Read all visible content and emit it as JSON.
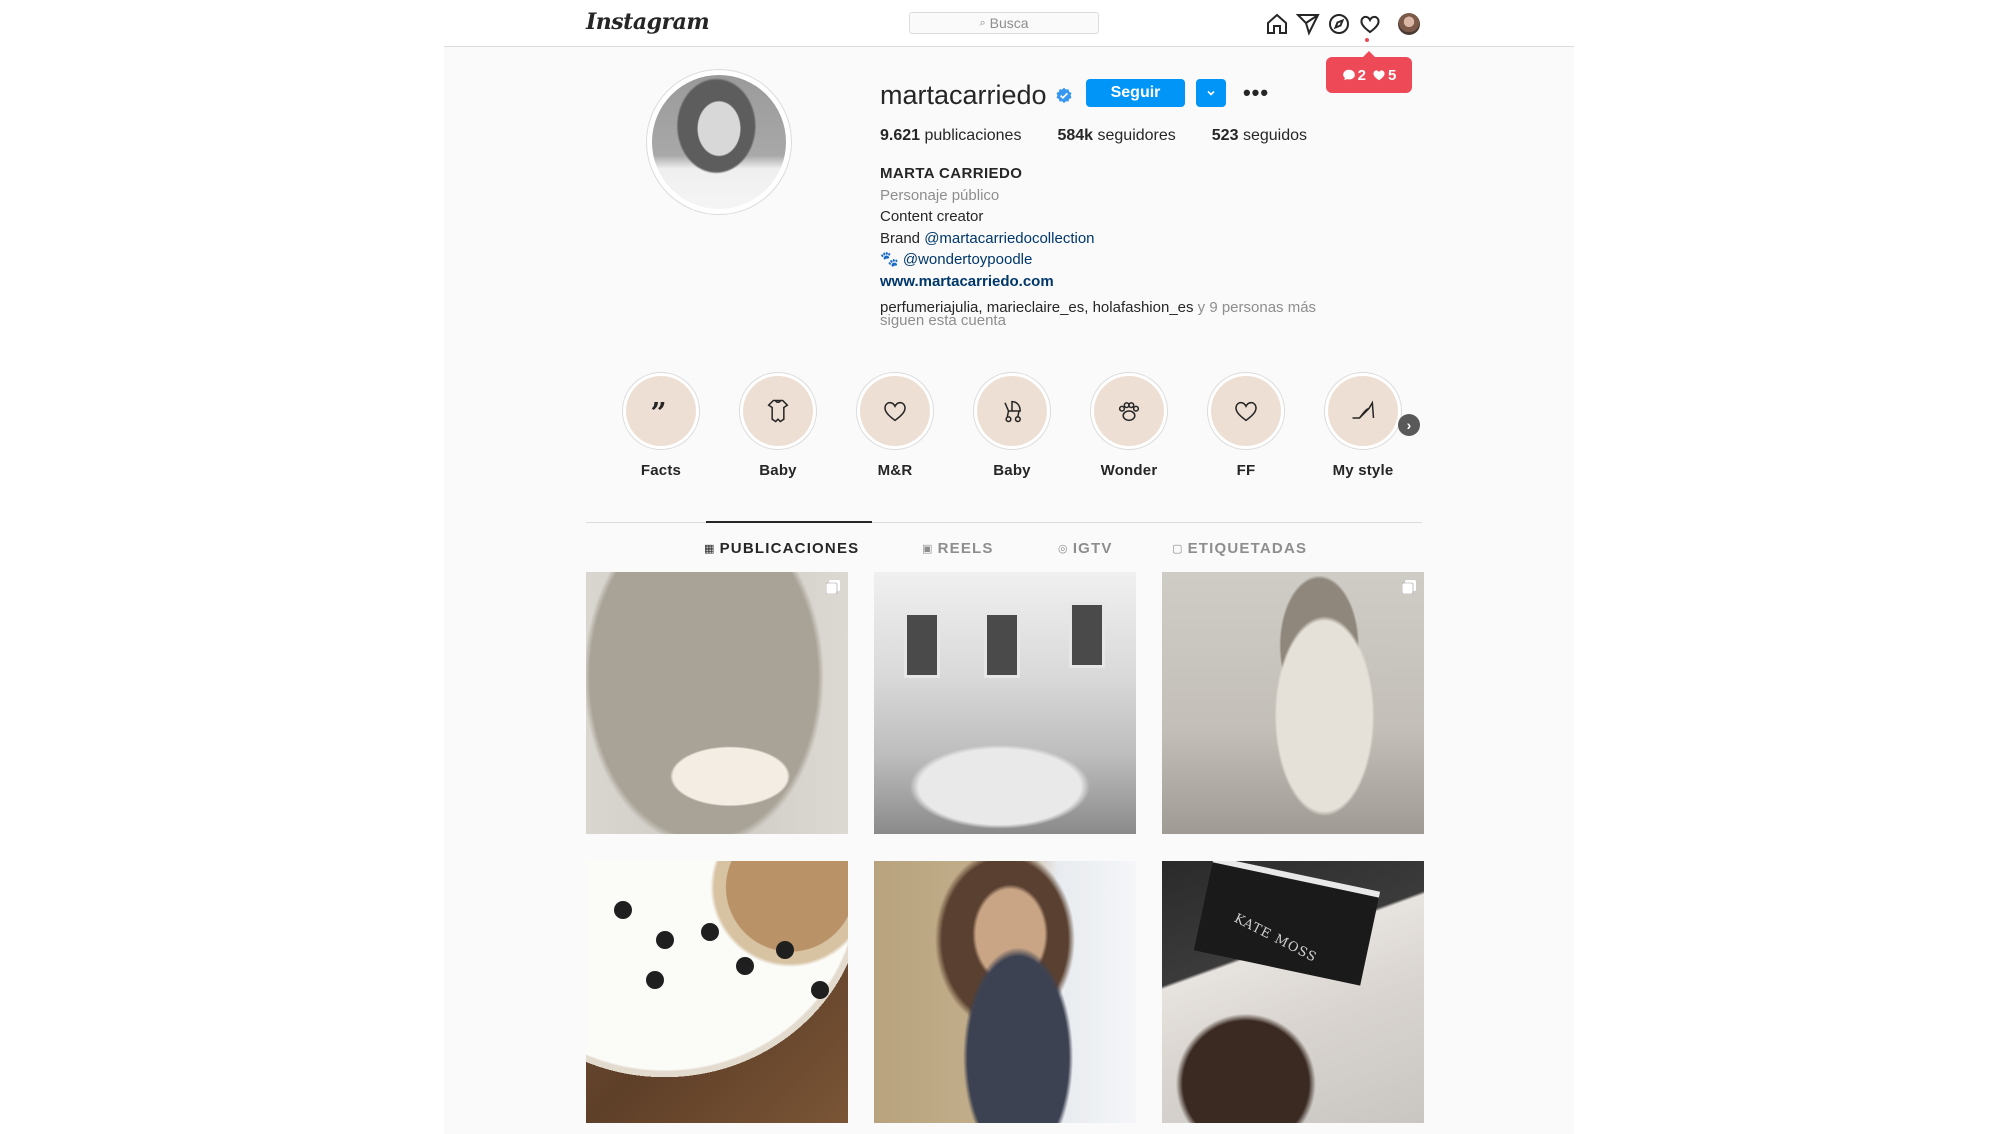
{
  "header": {
    "logo": "Instagram",
    "search_placeholder": "Busca",
    "notifications": {
      "comments": "2",
      "likes": "5"
    }
  },
  "profile": {
    "username": "martacarriedo",
    "follow_label": "Seguir",
    "stats": {
      "posts_count": "9.621",
      "posts_label": "publicaciones",
      "followers_count": "584k",
      "followers_label": "seguidores",
      "following_count": "523",
      "following_label": "seguidos"
    },
    "bio": {
      "name": "MARTA CARRIEDO",
      "category": "Personaje público",
      "line1": "Content creator",
      "brand_prefix": "Brand ",
      "brand_handle": "@martacarriedocollection",
      "pet_emoji": "🐾",
      "pet_handle": "@wondertoypoodle",
      "website": "www.martacarriedo.com"
    },
    "followed_by": {
      "accounts": "perfumeriajulia, marieclaire_es, holafashion_es",
      "rest": " y 9 personas más",
      "suffix": "siguen esta cuenta"
    }
  },
  "highlights": [
    {
      "label": "Facts",
      "icon": "quote-icon"
    },
    {
      "label": "Baby",
      "icon": "onesie-icon"
    },
    {
      "label": "M&R",
      "icon": "heart-icon"
    },
    {
      "label": "Baby",
      "icon": "stroller-icon"
    },
    {
      "label": "Wonder",
      "icon": "paw-icon"
    },
    {
      "label": "FF",
      "icon": "heart-icon"
    },
    {
      "label": "My style",
      "icon": "heel-shoe-icon"
    }
  ],
  "tabs": [
    {
      "label": "PUBLICACIONES",
      "active": true
    },
    {
      "label": "REELS",
      "active": false
    },
    {
      "label": "IGTV",
      "active": false
    },
    {
      "label": "ETIQUETADAS",
      "active": false
    }
  ],
  "posts": {
    "p6_book_text": "KATE MOSS"
  },
  "colors": {
    "accent": "#0095f6",
    "notification": "#ed4956",
    "link": "#00376b",
    "highlight_bg": "#eedfd4"
  }
}
